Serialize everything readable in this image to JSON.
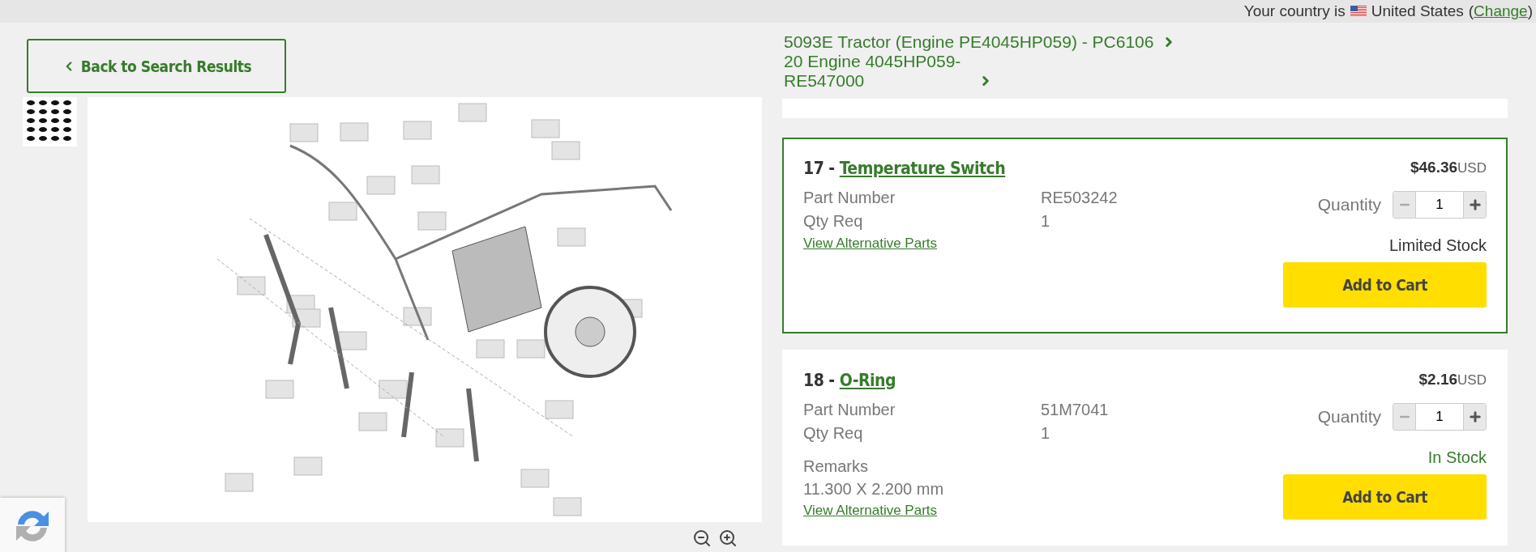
{
  "top_bar": {
    "country_label": "Your country is",
    "country": "United States",
    "paren_open": "(",
    "change_link": "Change",
    "paren_close": ")"
  },
  "back_button": {
    "label": "Back to Search Results"
  },
  "breadcrumb": [
    {
      "label": "5093E Tractor (Engine PE4045HP059) - PC6106"
    },
    {
      "label": "20 Engine 4045HP059-RE547000"
    }
  ],
  "parts": [
    {
      "number": "17 -",
      "name": "Temperature Switch",
      "selected": true,
      "price": "$46.36",
      "currency": "USD",
      "fields": [
        {
          "label": "Part Number",
          "value": "RE503242"
        },
        {
          "label": "Qty Req",
          "value": "1"
        }
      ],
      "link": "View Alternative Parts",
      "quantity_label": "Quantity",
      "quantity": "1",
      "stock": "Limited Stock",
      "in_stock": false,
      "button": "Add to Cart"
    },
    {
      "number": "18 -",
      "name": "O-Ring",
      "selected": false,
      "price": "$2.16",
      "currency": "USD",
      "fields": [
        {
          "label": "Part Number",
          "value": "51M7041"
        },
        {
          "label": "Qty Req",
          "value": "1"
        }
      ],
      "remarks": {
        "label": "Remarks",
        "value": "11.300 X 2.200 mm"
      },
      "link": "View Alternative Parts",
      "quantity_label": "Quantity",
      "quantity": "1",
      "stock": "In Stock",
      "in_stock": true,
      "button": "Add to Cart"
    }
  ]
}
